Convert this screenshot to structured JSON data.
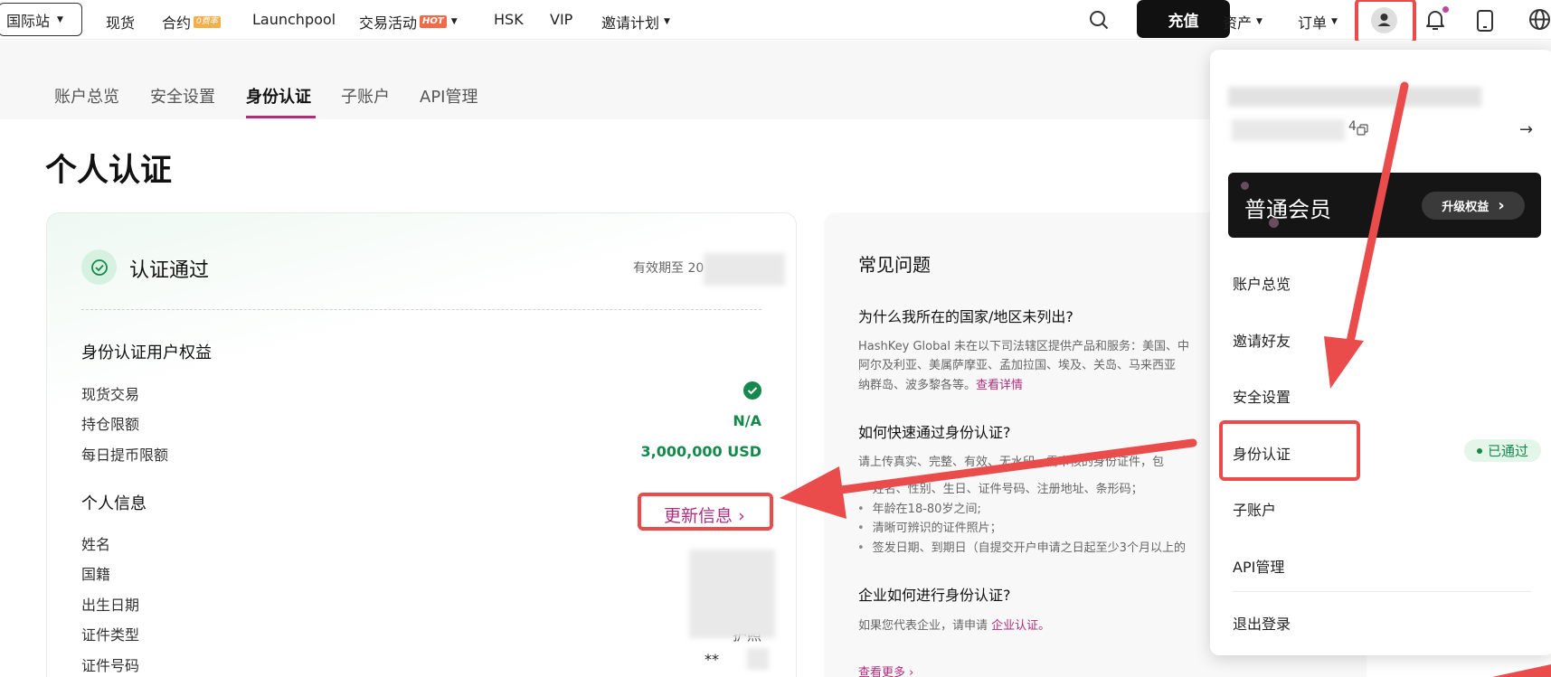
{
  "topnav": {
    "site_label": "国际站",
    "items": [
      {
        "label": "现货"
      },
      {
        "label": "合约",
        "badge": "0费率"
      },
      {
        "label": "Launchpool"
      },
      {
        "label": "交易活动",
        "badge": "HOT"
      },
      {
        "label": "HSK"
      },
      {
        "label": "VIP"
      },
      {
        "label": "邀请计划"
      }
    ],
    "deposit_label": "充值",
    "assets_label": "资产",
    "orders_label": "订单"
  },
  "subnav": {
    "tabs": [
      {
        "label": "账户总览"
      },
      {
        "label": "安全设置"
      },
      {
        "label": "身份认证"
      },
      {
        "label": "子账户"
      },
      {
        "label": "API管理"
      }
    ],
    "active_tab": "身份认证"
  },
  "page": {
    "title": "个人认证"
  },
  "verification": {
    "status": "认证通过",
    "valid_until": "有效期至 20",
    "benefits_title": "身份认证用户权益",
    "benefits": [
      {
        "label": "现货交易",
        "value": ""
      },
      {
        "label": "持仓限额",
        "value": "N/A"
      },
      {
        "label": "每日提币限额",
        "value": "3,000,000 USD"
      }
    ],
    "personal_title": "个人信息",
    "update_link": "更新信息",
    "fields": [
      {
        "label": "姓名",
        "value": ""
      },
      {
        "label": "国籍",
        "value": ""
      },
      {
        "label": "出生日期",
        "value": ""
      },
      {
        "label": "证件类型",
        "value": "护照"
      },
      {
        "label": "证件号码",
        "value": "**"
      }
    ]
  },
  "faq": {
    "title": "常见问题",
    "q1": "为什么我所在的国家/地区未列出?",
    "a1_line1": "HashKey Global 未在以下司法辖区提供产品和服务：美国、中",
    "a1_line2": "阿尔及利亚、美属萨摩亚、孟加拉国、埃及、关岛、马来西亚",
    "a1_line3": "纳群岛、波多黎各等。",
    "a1_link": "查看详情",
    "q2": "如何快速通过身份认证?",
    "a2_intro": "请上传真实、完整、有效、无水印、需审核的身份证件，包",
    "a2_bullets": [
      "姓名、性别、生日、证件号码、注册地址、条形码；",
      "年龄在18-80岁之间;",
      "清晰可辨识的证件照片；",
      "签发日期、到期日（自提交开户申请之日起至少3个月以上的"
    ],
    "q3": "企业如何进行身份认证?",
    "a3_text": "如果您代表企业，请申请",
    "a3_link": "企业认证。",
    "see_more": "查看更多"
  },
  "dropdown": {
    "uid_suffix": "4",
    "member_level": "普通会员",
    "upgrade_label": "升级权益",
    "menu": [
      {
        "label": "账户总览"
      },
      {
        "label": "邀请好友"
      },
      {
        "label": "安全设置"
      },
      {
        "label": "身份认证",
        "badge": "已通过"
      },
      {
        "label": "子账户"
      },
      {
        "label": "API管理"
      },
      {
        "label": "退出登录"
      }
    ]
  },
  "colors": {
    "accent": "#b32c7c",
    "success": "#15884b",
    "annotation_red": "#ea4b4b"
  }
}
